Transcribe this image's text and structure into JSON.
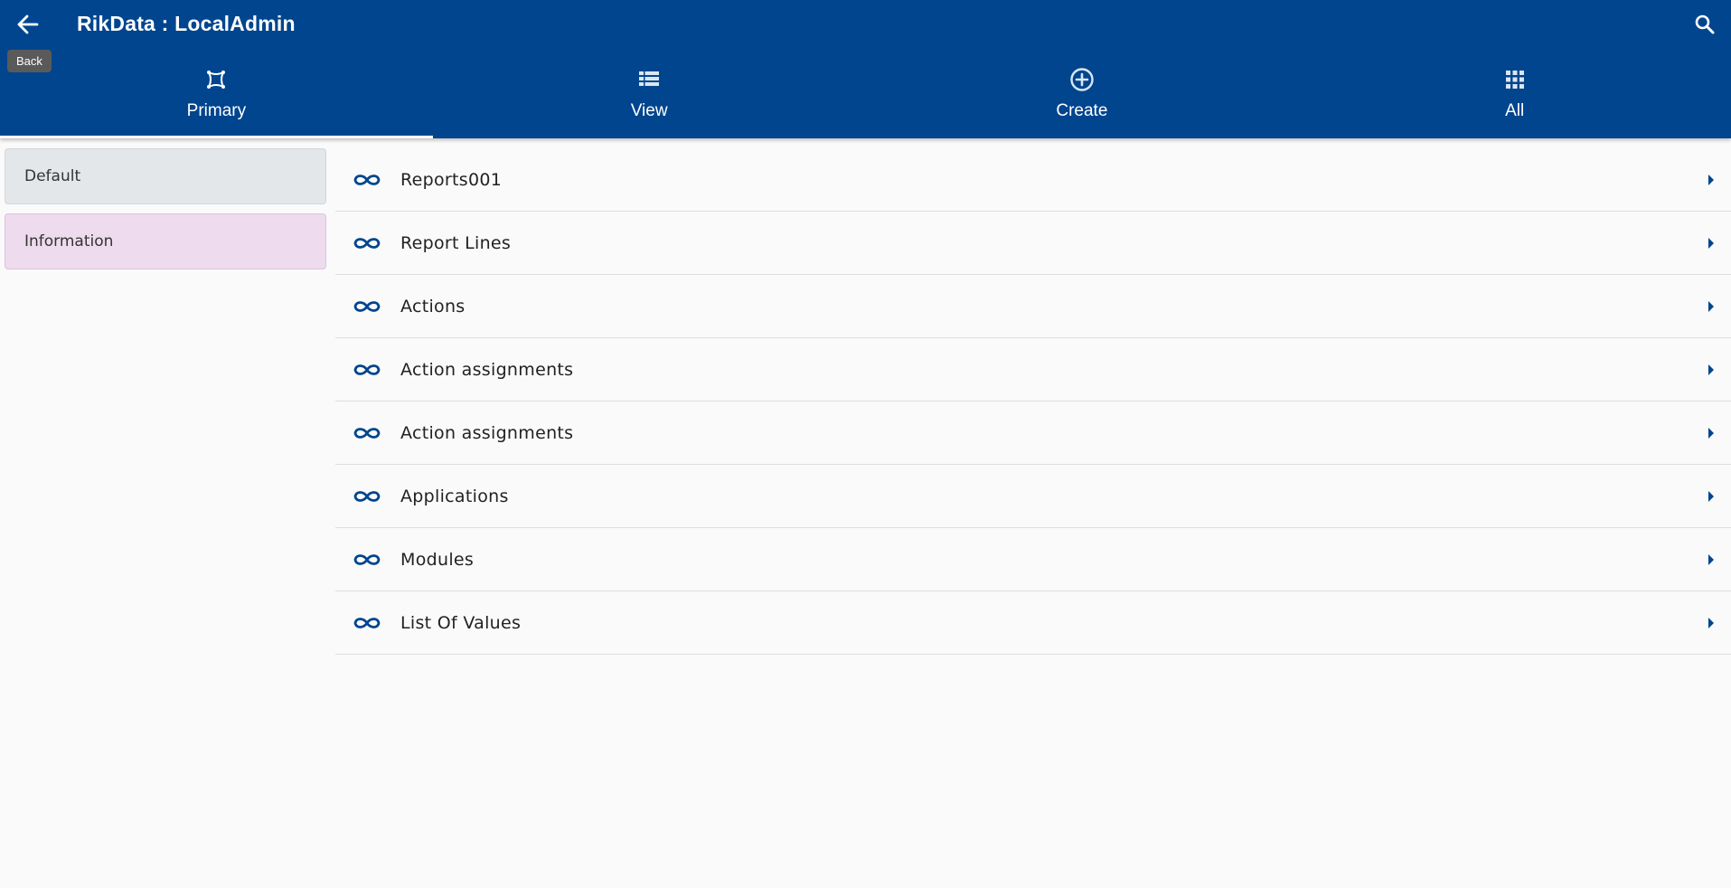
{
  "header": {
    "title": "RikData : LocalAdmin",
    "back_tooltip": "Back",
    "back_icon": "arrow-left-icon",
    "search_icon": "search-icon",
    "background": "#00458e"
  },
  "tabs": [
    {
      "label": "Primary",
      "icon": "primary-icon",
      "active": true
    },
    {
      "label": "View",
      "icon": "list-view-icon",
      "active": false
    },
    {
      "label": "Create",
      "icon": "plus-circle-icon",
      "active": false
    },
    {
      "label": "All",
      "icon": "grid-icon",
      "active": false
    }
  ],
  "sidebar": {
    "items": [
      {
        "label": "Default",
        "color": "#e3e7ea"
      },
      {
        "label": "Information",
        "color": "#eedcee"
      }
    ]
  },
  "list": {
    "items": [
      {
        "label": "Reports001"
      },
      {
        "label": "Report Lines"
      },
      {
        "label": "Actions"
      },
      {
        "label": "Action assignments"
      },
      {
        "label": "Action assignments"
      },
      {
        "label": "Applications"
      },
      {
        "label": "Modules"
      },
      {
        "label": "List Of Values"
      }
    ],
    "icon": "link-icon",
    "chevron": "chevron-right-icon",
    "accent": "#00458e"
  }
}
